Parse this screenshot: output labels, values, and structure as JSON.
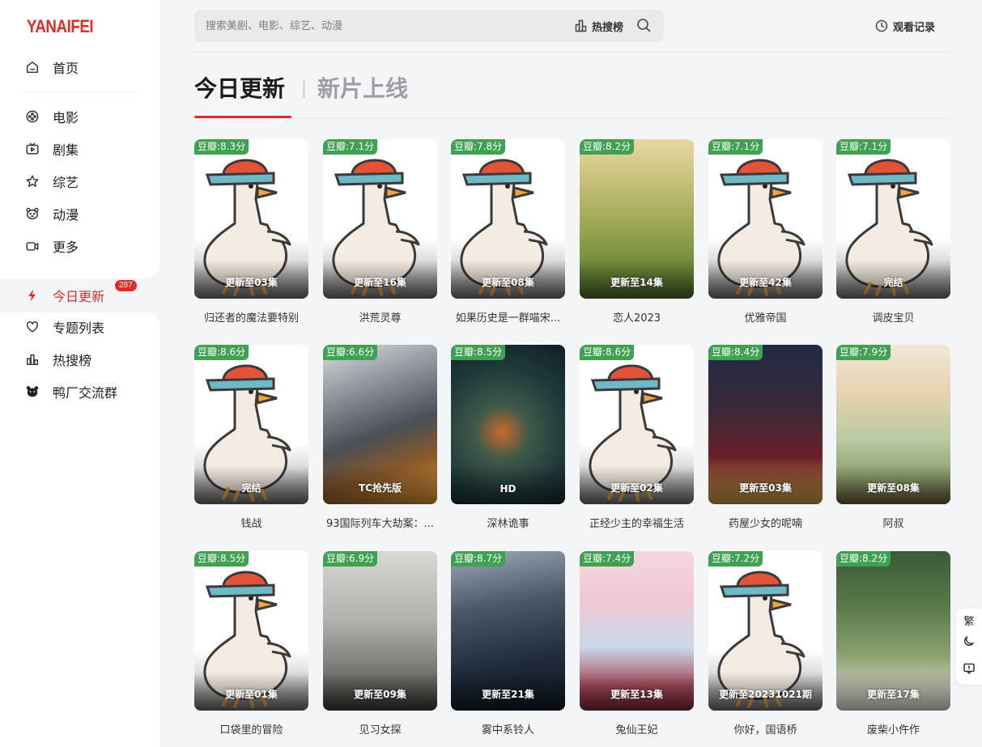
{
  "brand": {
    "logo_text": "YANAIFEI",
    "accent_color": "#e12b2b"
  },
  "sidebar": {
    "items": [
      {
        "label": "首页",
        "icon": "home-icon"
      },
      {
        "label": "电影",
        "icon": "film-reel-icon"
      },
      {
        "label": "剧集",
        "icon": "tv-icon"
      },
      {
        "label": "综艺",
        "icon": "star-icon"
      },
      {
        "label": "动漫",
        "icon": "bear-face-icon"
      },
      {
        "label": "更多",
        "icon": "camera-icon"
      },
      {
        "label": "今日更新",
        "icon": "lightning-icon",
        "active": true,
        "badge": "287"
      },
      {
        "label": "专题列表",
        "icon": "heart-icon"
      },
      {
        "label": "热搜榜",
        "icon": "bar-chart-icon"
      },
      {
        "label": "鸭厂交流群",
        "icon": "bear-face-icon"
      }
    ]
  },
  "header": {
    "search_placeholder": "搜索美剧、电影、综艺、动漫",
    "hot_label": "热搜榜",
    "history_label": "观看记录"
  },
  "tabs": [
    {
      "label": "今日更新",
      "active": true
    },
    {
      "label": "新片上线",
      "active": false
    }
  ],
  "score_color": "#3fa152",
  "cards": [
    {
      "title": "归还者的魔法要特别",
      "score": "豆瓣:8.3分",
      "status": "更新至03集",
      "poster": "duck"
    },
    {
      "title": "洪荒灵尊",
      "score": "豆瓣:7.1分",
      "status": "更新至16集",
      "poster": "duck"
    },
    {
      "title": "如果历史是一群喵宋...",
      "score": "豆瓣:7.8分",
      "status": "更新至08集",
      "poster": "duck"
    },
    {
      "title": "恋人2023",
      "score": "豆瓣:8.2分",
      "status": "更新至14集",
      "poster": "grass"
    },
    {
      "title": "优雅帝国",
      "score": "豆瓣:7.1分",
      "status": "更新至42集",
      "poster": "duck"
    },
    {
      "title": "调皮宝贝",
      "score": "豆瓣:7.1分",
      "status": "完结",
      "poster": "duck"
    },
    {
      "title": "钱战",
      "score": "豆瓣:8.6分",
      "status": "完结",
      "poster": "duck"
    },
    {
      "title": "93国际列车大劫案：...",
      "score": "豆瓣:6.6分",
      "status": "TC抢先版",
      "poster": "action"
    },
    {
      "title": "深林诡事",
      "score": "豆瓣:8.5分",
      "status": "HD",
      "poster": "forest"
    },
    {
      "title": "正经少主的幸福生活",
      "score": "豆瓣:8.6分",
      "status": "更新至02集",
      "poster": "duck"
    },
    {
      "title": "药屋少女的呢喃",
      "score": "豆瓣:8.4分",
      "status": "更新至03集",
      "poster": "anime"
    },
    {
      "title": "阿叔",
      "score": "豆瓣:7.9分",
      "status": "更新至08集",
      "poster": "family"
    },
    {
      "title": "口袋里的冒险",
      "score": "豆瓣:8.5分",
      "status": "更新至01集",
      "poster": "duck"
    },
    {
      "title": "见习女探",
      "score": "豆瓣:6.9分",
      "status": "更新至09集",
      "poster": "detective"
    },
    {
      "title": "雾中系铃人",
      "score": "豆瓣:8.7分",
      "status": "更新至21集",
      "poster": "police"
    },
    {
      "title": "兔仙王妃",
      "score": "豆瓣:7.4分",
      "status": "更新至13集",
      "poster": "costume"
    },
    {
      "title": "你好，国语桥",
      "score": "豆瓣:7.2分",
      "status": "更新至20231021期",
      "poster": "duck"
    },
    {
      "title": "废柴小仵作",
      "score": "豆瓣:8.2分",
      "status": "更新至17集",
      "poster": "bamboo"
    }
  ],
  "float_tools": {
    "traditional_label": "繁"
  }
}
